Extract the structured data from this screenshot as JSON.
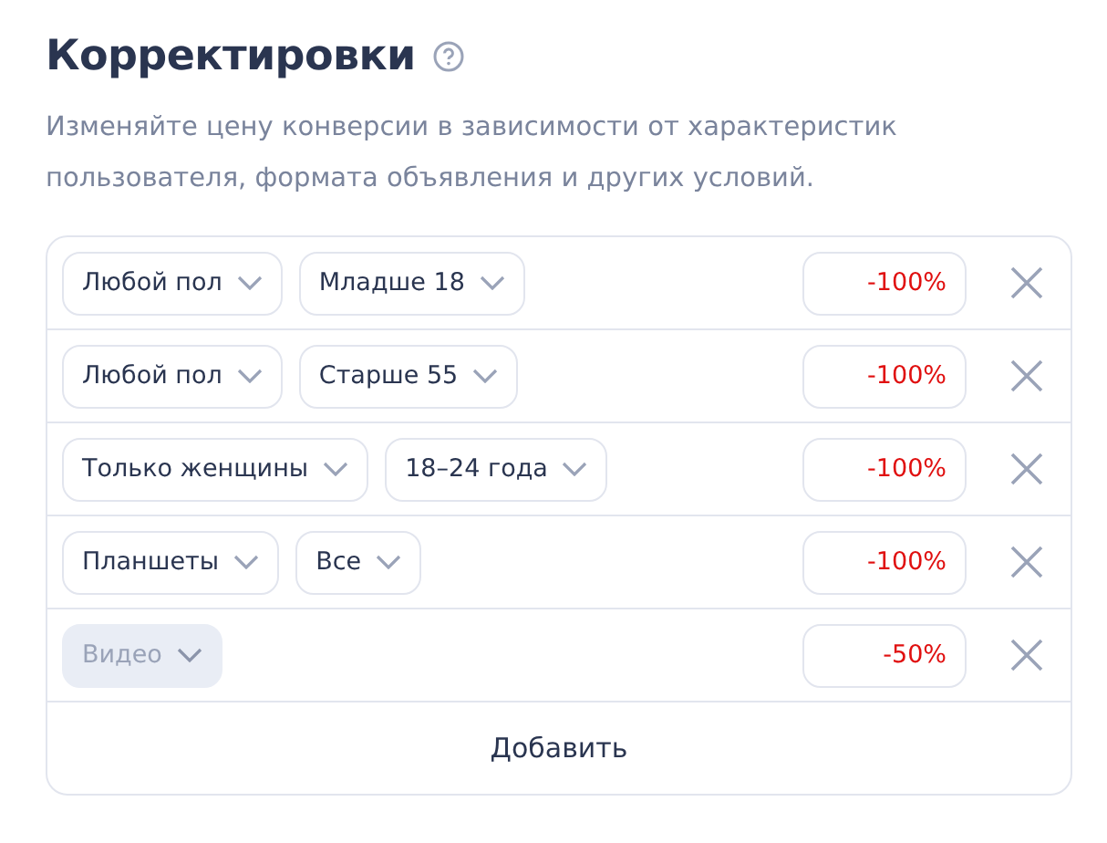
{
  "title": "Корректировки",
  "description": "Изменяйте цену конверсии в зависимости от характеристик пользователя, формата объявления и других условий.",
  "rows": [
    {
      "selects": [
        {
          "label": "Любой пол",
          "disabled": false
        },
        {
          "label": "Младше 18",
          "disabled": false
        }
      ],
      "value": "-100%"
    },
    {
      "selects": [
        {
          "label": "Любой пол",
          "disabled": false
        },
        {
          "label": "Старше 55",
          "disabled": false
        }
      ],
      "value": "-100%"
    },
    {
      "selects": [
        {
          "label": "Только женщины",
          "disabled": false
        },
        {
          "label": "18–24 года",
          "disabled": false
        }
      ],
      "value": "-100%"
    },
    {
      "selects": [
        {
          "label": "Планшеты",
          "disabled": false
        },
        {
          "label": "Все",
          "disabled": false
        }
      ],
      "value": "-100%"
    },
    {
      "selects": [
        {
          "label": "Видео",
          "disabled": true
        }
      ],
      "value": "-50%"
    }
  ],
  "add_button": "Добавить"
}
